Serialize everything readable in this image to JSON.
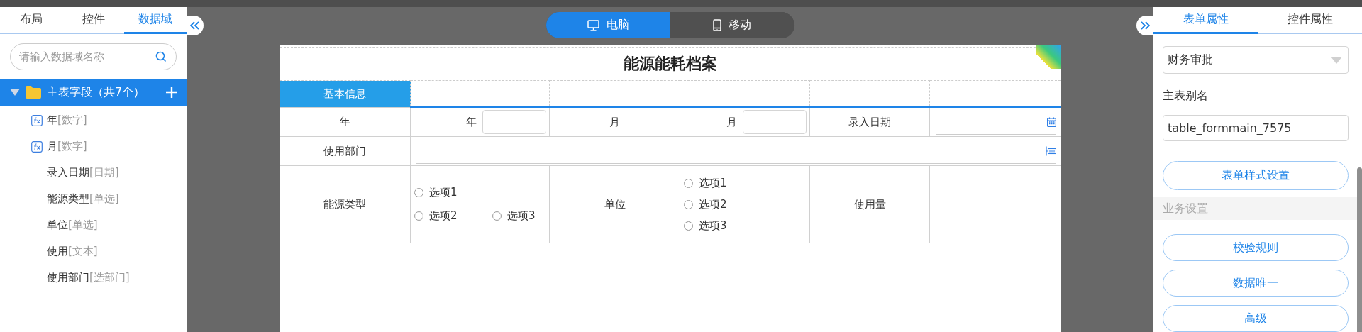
{
  "left_panel": {
    "tabs": [
      {
        "label": "布局",
        "selected": false
      },
      {
        "label": "控件",
        "selected": false
      },
      {
        "label": "数据域",
        "selected": true
      }
    ],
    "search": {
      "placeholder": "请输入数据域名称"
    },
    "tree": {
      "label": "主表字段（共7个）",
      "expanded": true,
      "children": [
        {
          "name": "年",
          "type": "[数字]",
          "kind": "formula"
        },
        {
          "name": "月",
          "type": "[数字]",
          "kind": "formula"
        },
        {
          "name": "录入日期",
          "type": "[日期]",
          "kind": "field"
        },
        {
          "name": "能源类型",
          "type": "[单选]",
          "kind": "field"
        },
        {
          "name": "单位",
          "type": "[单选]",
          "kind": "field"
        },
        {
          "name": "使用",
          "type": "[文本]",
          "kind": "field"
        },
        {
          "name": "使用部门",
          "type": "[选部门]",
          "kind": "field"
        }
      ]
    }
  },
  "view_modes": [
    {
      "label": "电脑",
      "kind": "desktop",
      "selected": true
    },
    {
      "label": "移动",
      "kind": "mobile",
      "selected": false
    }
  ],
  "form": {
    "title": "能源能耗档案",
    "section": "基本信息",
    "year_label": "年",
    "year_field_label": "年",
    "month_label": "月",
    "month_field_label": "月",
    "date_label": "录入日期",
    "dept_label": "使用部门",
    "energy_label": "能源类型",
    "energy_options": [
      {
        "label": "选项1",
        "selected": false
      },
      {
        "label": "选项2",
        "selected": false
      },
      {
        "label": "选项3",
        "selected": false
      }
    ],
    "unit_label": "单位",
    "unit_options": [
      {
        "label": "选项1",
        "selected": false
      },
      {
        "label": "选项2",
        "selected": false
      },
      {
        "label": "选项3",
        "selected": false
      }
    ],
    "usage_label": "使用量"
  },
  "right_panel": {
    "tabs": [
      {
        "label": "表单属性",
        "selected": true
      },
      {
        "label": "控件属性",
        "selected": false
      }
    ],
    "category": "财务审批",
    "alias_label": "主表别名",
    "alias_value": "table_formmain_7575",
    "style_button": "表单样式设置",
    "section": "业务设置",
    "buttons": [
      "校验规则",
      "数据唯一",
      "高级"
    ]
  }
}
